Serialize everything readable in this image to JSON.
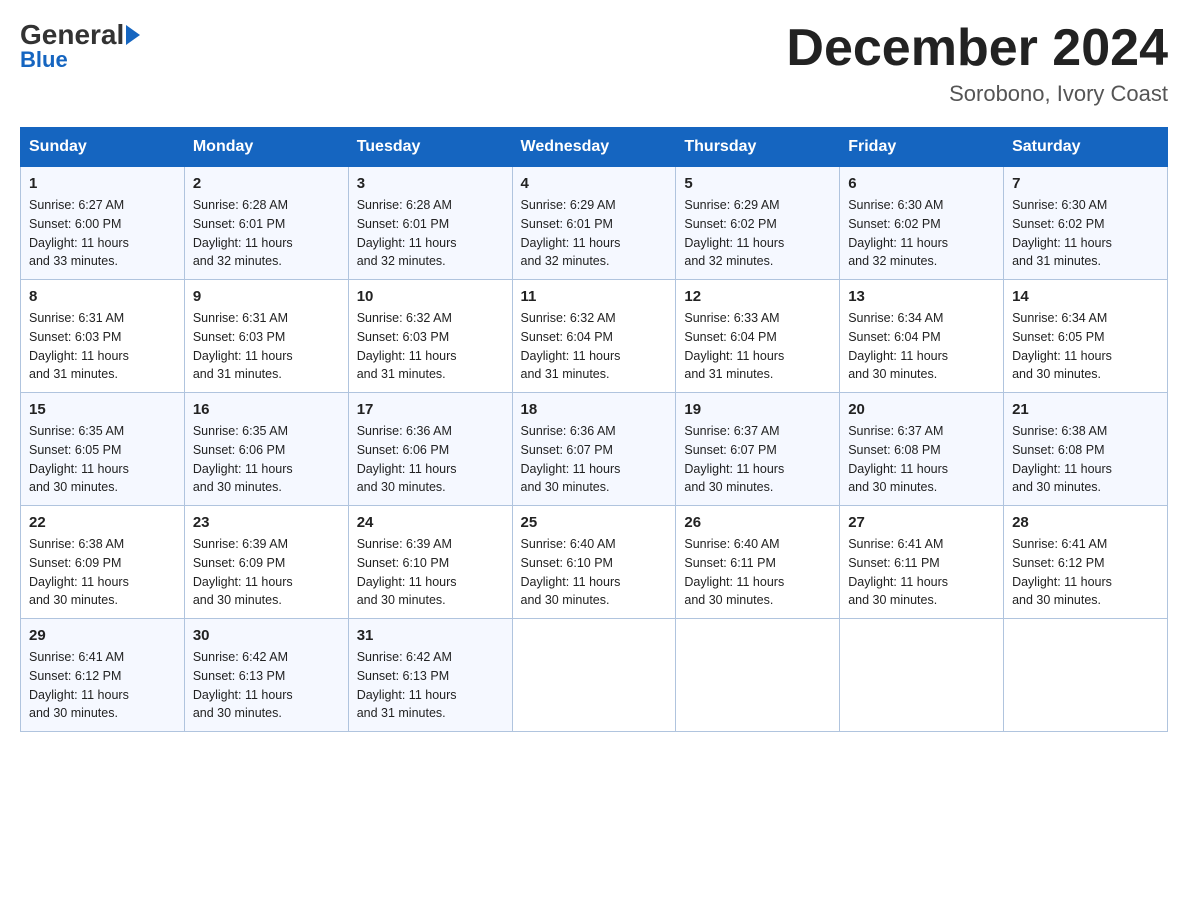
{
  "header": {
    "logo_line1": "General",
    "logo_line2": "Blue",
    "month_title": "December 2024",
    "location": "Sorobono, Ivory Coast"
  },
  "days_of_week": [
    "Sunday",
    "Monday",
    "Tuesday",
    "Wednesday",
    "Thursday",
    "Friday",
    "Saturday"
  ],
  "weeks": [
    [
      {
        "day": "1",
        "sunrise": "6:27 AM",
        "sunset": "6:00 PM",
        "daylight": "11 hours and 33 minutes."
      },
      {
        "day": "2",
        "sunrise": "6:28 AM",
        "sunset": "6:01 PM",
        "daylight": "11 hours and 32 minutes."
      },
      {
        "day": "3",
        "sunrise": "6:28 AM",
        "sunset": "6:01 PM",
        "daylight": "11 hours and 32 minutes."
      },
      {
        "day": "4",
        "sunrise": "6:29 AM",
        "sunset": "6:01 PM",
        "daylight": "11 hours and 32 minutes."
      },
      {
        "day": "5",
        "sunrise": "6:29 AM",
        "sunset": "6:02 PM",
        "daylight": "11 hours and 32 minutes."
      },
      {
        "day": "6",
        "sunrise": "6:30 AM",
        "sunset": "6:02 PM",
        "daylight": "11 hours and 32 minutes."
      },
      {
        "day": "7",
        "sunrise": "6:30 AM",
        "sunset": "6:02 PM",
        "daylight": "11 hours and 31 minutes."
      }
    ],
    [
      {
        "day": "8",
        "sunrise": "6:31 AM",
        "sunset": "6:03 PM",
        "daylight": "11 hours and 31 minutes."
      },
      {
        "day": "9",
        "sunrise": "6:31 AM",
        "sunset": "6:03 PM",
        "daylight": "11 hours and 31 minutes."
      },
      {
        "day": "10",
        "sunrise": "6:32 AM",
        "sunset": "6:03 PM",
        "daylight": "11 hours and 31 minutes."
      },
      {
        "day": "11",
        "sunrise": "6:32 AM",
        "sunset": "6:04 PM",
        "daylight": "11 hours and 31 minutes."
      },
      {
        "day": "12",
        "sunrise": "6:33 AM",
        "sunset": "6:04 PM",
        "daylight": "11 hours and 31 minutes."
      },
      {
        "day": "13",
        "sunrise": "6:34 AM",
        "sunset": "6:04 PM",
        "daylight": "11 hours and 30 minutes."
      },
      {
        "day": "14",
        "sunrise": "6:34 AM",
        "sunset": "6:05 PM",
        "daylight": "11 hours and 30 minutes."
      }
    ],
    [
      {
        "day": "15",
        "sunrise": "6:35 AM",
        "sunset": "6:05 PM",
        "daylight": "11 hours and 30 minutes."
      },
      {
        "day": "16",
        "sunrise": "6:35 AM",
        "sunset": "6:06 PM",
        "daylight": "11 hours and 30 minutes."
      },
      {
        "day": "17",
        "sunrise": "6:36 AM",
        "sunset": "6:06 PM",
        "daylight": "11 hours and 30 minutes."
      },
      {
        "day": "18",
        "sunrise": "6:36 AM",
        "sunset": "6:07 PM",
        "daylight": "11 hours and 30 minutes."
      },
      {
        "day": "19",
        "sunrise": "6:37 AM",
        "sunset": "6:07 PM",
        "daylight": "11 hours and 30 minutes."
      },
      {
        "day": "20",
        "sunrise": "6:37 AM",
        "sunset": "6:08 PM",
        "daylight": "11 hours and 30 minutes."
      },
      {
        "day": "21",
        "sunrise": "6:38 AM",
        "sunset": "6:08 PM",
        "daylight": "11 hours and 30 minutes."
      }
    ],
    [
      {
        "day": "22",
        "sunrise": "6:38 AM",
        "sunset": "6:09 PM",
        "daylight": "11 hours and 30 minutes."
      },
      {
        "day": "23",
        "sunrise": "6:39 AM",
        "sunset": "6:09 PM",
        "daylight": "11 hours and 30 minutes."
      },
      {
        "day": "24",
        "sunrise": "6:39 AM",
        "sunset": "6:10 PM",
        "daylight": "11 hours and 30 minutes."
      },
      {
        "day": "25",
        "sunrise": "6:40 AM",
        "sunset": "6:10 PM",
        "daylight": "11 hours and 30 minutes."
      },
      {
        "day": "26",
        "sunrise": "6:40 AM",
        "sunset": "6:11 PM",
        "daylight": "11 hours and 30 minutes."
      },
      {
        "day": "27",
        "sunrise": "6:41 AM",
        "sunset": "6:11 PM",
        "daylight": "11 hours and 30 minutes."
      },
      {
        "day": "28",
        "sunrise": "6:41 AM",
        "sunset": "6:12 PM",
        "daylight": "11 hours and 30 minutes."
      }
    ],
    [
      {
        "day": "29",
        "sunrise": "6:41 AM",
        "sunset": "6:12 PM",
        "daylight": "11 hours and 30 minutes."
      },
      {
        "day": "30",
        "sunrise": "6:42 AM",
        "sunset": "6:13 PM",
        "daylight": "11 hours and 30 minutes."
      },
      {
        "day": "31",
        "sunrise": "6:42 AM",
        "sunset": "6:13 PM",
        "daylight": "11 hours and 31 minutes."
      },
      null,
      null,
      null,
      null
    ]
  ],
  "labels": {
    "sunrise": "Sunrise:",
    "sunset": "Sunset:",
    "daylight": "Daylight:"
  }
}
